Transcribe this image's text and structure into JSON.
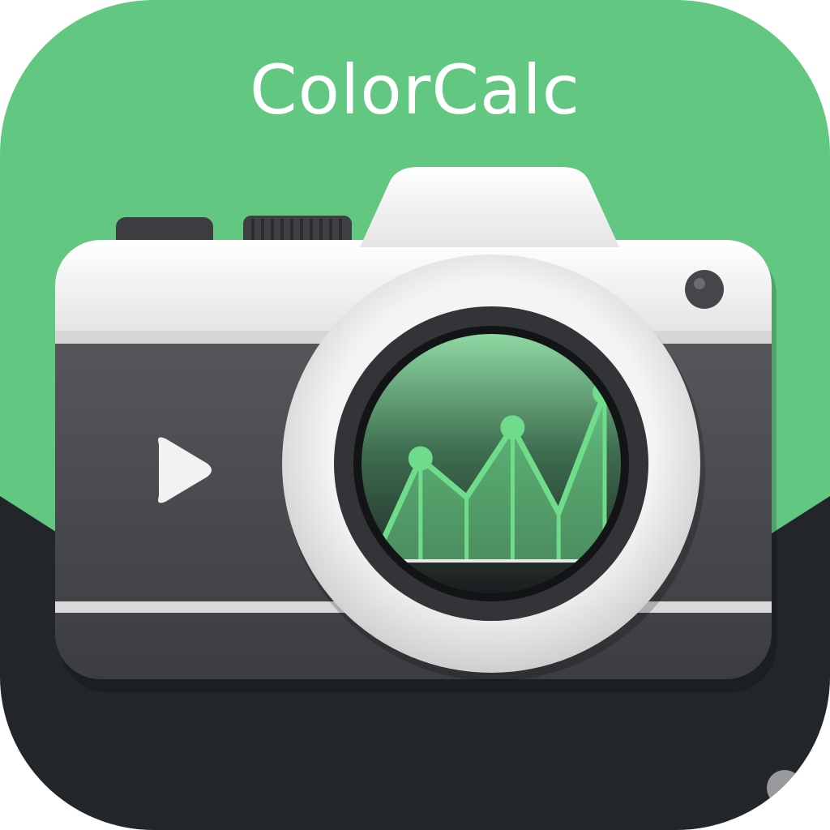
{
  "app": {
    "title": "ColorCalc"
  },
  "icon": {
    "subject": "camera-with-chart-lens-icon",
    "lens_chart": {
      "type": "area-line",
      "points": [
        0,
        2.6,
        1.6,
        3.4,
        1.2,
        4.3
      ]
    }
  },
  "colors": {
    "brand_green": "#62c781",
    "chart_green": "#6fdc8c",
    "dark_base": "#22262a",
    "camera_body_dark": "#4b4d51",
    "camera_top_white": "#f2f2f2"
  }
}
